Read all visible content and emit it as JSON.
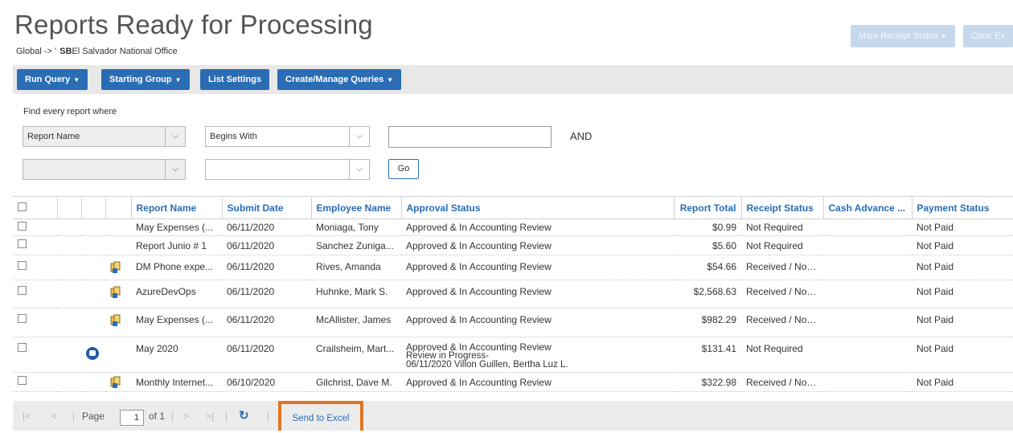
{
  "page": {
    "title": "Reports Ready for Processing",
    "breadcrumb_prefix": "Global -> '",
    "breadcrumb_sb": "SB",
    "breadcrumb_office": "El Salvador National Office"
  },
  "top_actions": {
    "mark_receipt_status": "Mark Receipt Status",
    "clear_exceptions": "Clear Ex"
  },
  "toolbar": {
    "run_query": "Run Query",
    "starting_group": "Starting Group",
    "list_settings": "List Settings",
    "create_manage_queries": "Create/Manage Queries"
  },
  "query": {
    "find_label": "Find every report where",
    "field_1": "Report Name",
    "operator_1": "Begins With",
    "value_1": "",
    "conjunction": "AND",
    "field_2": "",
    "operator_2": "",
    "go_label": "Go"
  },
  "grid": {
    "headers": {
      "report_name": "Report Name",
      "submit_date": "Submit Date",
      "employee_name": "Employee Name",
      "approval_status": "Approval Status",
      "report_total": "Report Total",
      "receipt_status": "Receipt Status",
      "cash_advance": "Cash Advance ...",
      "payment_status": "Payment Status"
    },
    "rows": [
      {
        "icon": "",
        "report_name": "May Expenses (...",
        "submit_date": "06/11/2020",
        "employee": "Moniaga, Tony",
        "approval": "Approved & In Accounting Review",
        "approval_2": "",
        "approval_3": "",
        "total": "$0.99",
        "receipt": "Not Required",
        "cash_advance": "",
        "payment": "Not Paid"
      },
      {
        "icon": "",
        "report_name": "Report Junio # 1",
        "submit_date": "06/11/2020",
        "employee": "Sanchez Zuniga...",
        "approval": "Approved & In Accounting Review",
        "approval_2": "",
        "approval_3": "",
        "total": "$5.60",
        "receipt": "Not Required",
        "cash_advance": "",
        "payment": "Not Paid"
      },
      {
        "icon": "receipt-icon",
        "report_name": "DM Phone expe...",
        "submit_date": "06/11/2020",
        "employee": "Rives, Amanda",
        "approval": "Approved & In Accounting Review",
        "approval_2": "",
        "approval_3": "",
        "total": "$54.66",
        "receipt": "Received / Not ...",
        "cash_advance": "",
        "payment": "Not Paid"
      },
      {
        "icon": "receipt-icon",
        "report_name": "AzureDevOps",
        "submit_date": "06/11/2020",
        "employee": "Huhnke, Mark S.",
        "approval": "Approved & In Accounting Review",
        "approval_2": "",
        "approval_3": "",
        "total": "$2,568.63",
        "receipt": "Received / Not ...",
        "cash_advance": "",
        "payment": "Not Paid"
      },
      {
        "icon": "receipt-icon",
        "report_name": "May Expenses (...",
        "submit_date": "06/11/2020",
        "employee": "McAllister, James",
        "approval": "Approved & In Accounting Review",
        "approval_2": "",
        "approval_3": "",
        "total": "$982.29",
        "receipt": "Received / Not ...",
        "cash_advance": "",
        "payment": "Not Paid"
      },
      {
        "icon": "comment-icon",
        "report_name": "May 2020",
        "submit_date": "06/11/2020",
        "employee": "Crailsheim, Mart...",
        "approval": "Approved & In Accounting Review",
        "approval_2": "Review in Progress-",
        "approval_3": "06/11/2020 Villon Guillen, Bertha Luz L.",
        "total": "$131.41",
        "receipt": "Not Required",
        "cash_advance": "",
        "payment": "Not Paid"
      },
      {
        "icon": "receipt-icon",
        "report_name": "Monthly Internet...",
        "submit_date": "06/10/2020",
        "employee": "Gilchrist, Dave M.",
        "approval": "Approved & In Accounting Review",
        "approval_2": "",
        "approval_3": "",
        "total": "$322.98",
        "receipt": "Received / Not ...",
        "cash_advance": "",
        "payment": "Not Paid"
      }
    ]
  },
  "pager": {
    "page_label": "Page",
    "page_number": "1",
    "of_label": "of 1",
    "send_to_excel": "Send to Excel"
  },
  "colors": {
    "primary_blue": "#2a6db5",
    "highlight_orange": "#e07522",
    "disabled_blue": "#c7d8ec"
  }
}
